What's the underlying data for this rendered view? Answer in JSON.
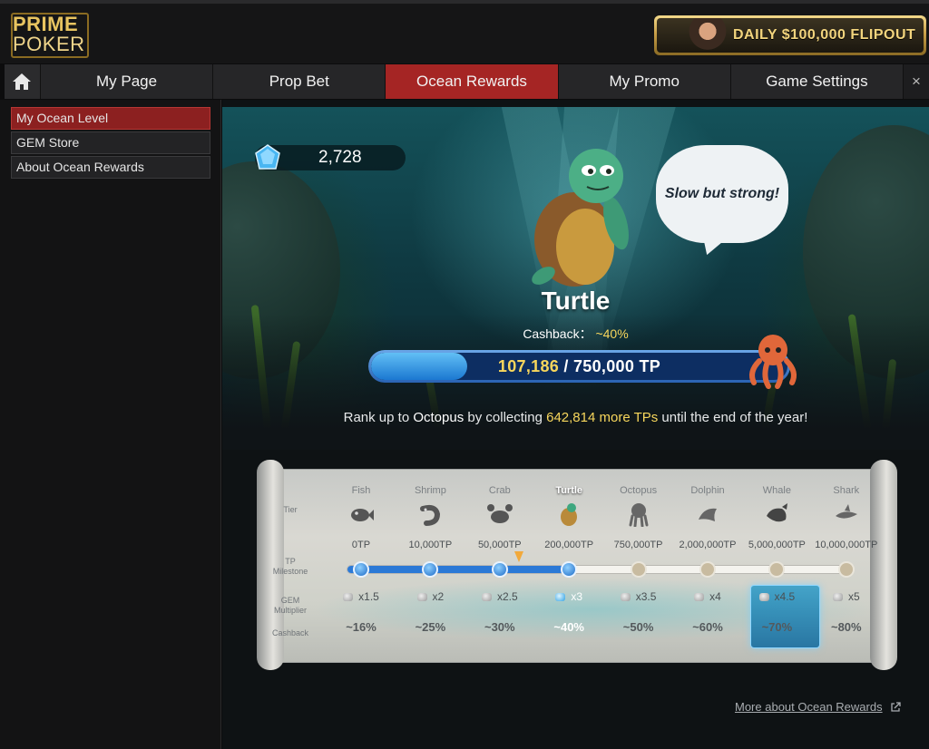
{
  "brand": {
    "logo_line1": "PRIME",
    "logo_line2": "POKER"
  },
  "promo": {
    "text": "DAILY $100,000 FLIPOUT"
  },
  "tabs": {
    "items": [
      {
        "label": "My Page"
      },
      {
        "label": "Prop Bet"
      },
      {
        "label": "Ocean Rewards",
        "active": true
      },
      {
        "label": "My Promo"
      },
      {
        "label": "Game Settings"
      }
    ],
    "close": "×"
  },
  "sidebar": {
    "items": [
      {
        "label": "My Ocean Level",
        "active": true
      },
      {
        "label": "GEM Store"
      },
      {
        "label": "About Ocean Rewards"
      }
    ]
  },
  "ocean": {
    "gems": "2,728",
    "speech": "Slow but strong!",
    "level": "Turtle",
    "cashback_label": "Cashback：",
    "cashback_value": "~40%",
    "progress": {
      "current": "107,186",
      "separator": " / ",
      "target": "750,000 TP",
      "fraction": 0.1429
    },
    "rank": {
      "prefix": "Rank up to ",
      "next_tier": "Octopus",
      "middle": " by collecting ",
      "amount": "642,814 more TPs",
      "suffix": " until the end of the year!"
    }
  },
  "tier_table": {
    "row_labels": {
      "tier": "Tier",
      "milestone": "TP Milestone",
      "multiplier": "GEM Multiplier",
      "cashback": "Cashback"
    },
    "current_index": 3,
    "tiers": [
      {
        "name": "Fish",
        "icon": "fish-icon",
        "milestone": "0TP",
        "multiplier": "x1.5",
        "cashback": "~16%"
      },
      {
        "name": "Shrimp",
        "icon": "shrimp-icon",
        "milestone": "10,000TP",
        "multiplier": "x2",
        "cashback": "~25%"
      },
      {
        "name": "Crab",
        "icon": "crab-icon",
        "milestone": "50,000TP",
        "multiplier": "x2.5",
        "cashback": "~30%"
      },
      {
        "name": "Turtle",
        "icon": "turtle-icon",
        "milestone": "200,000TP",
        "multiplier": "x3",
        "cashback": "~40%"
      },
      {
        "name": "Octopus",
        "icon": "octopus-icon",
        "milestone": "750,000TP",
        "multiplier": "x3.5",
        "cashback": "~50%"
      },
      {
        "name": "Dolphin",
        "icon": "dolphin-icon",
        "milestone": "2,000,000TP",
        "multiplier": "x4",
        "cashback": "~60%"
      },
      {
        "name": "Whale",
        "icon": "whale-icon",
        "milestone": "5,000,000TP",
        "multiplier": "x4.5",
        "cashback": "~70%"
      },
      {
        "name": "Shark",
        "icon": "shark-icon",
        "milestone": "10,000,000TP",
        "multiplier": "x5",
        "cashback": "~80%"
      }
    ]
  },
  "footer": {
    "more_link": "More about Ocean Rewards"
  },
  "colors": {
    "accent_red": "#a52524",
    "gold": "#f7d65c",
    "progress_blue": "#2b79d6"
  }
}
